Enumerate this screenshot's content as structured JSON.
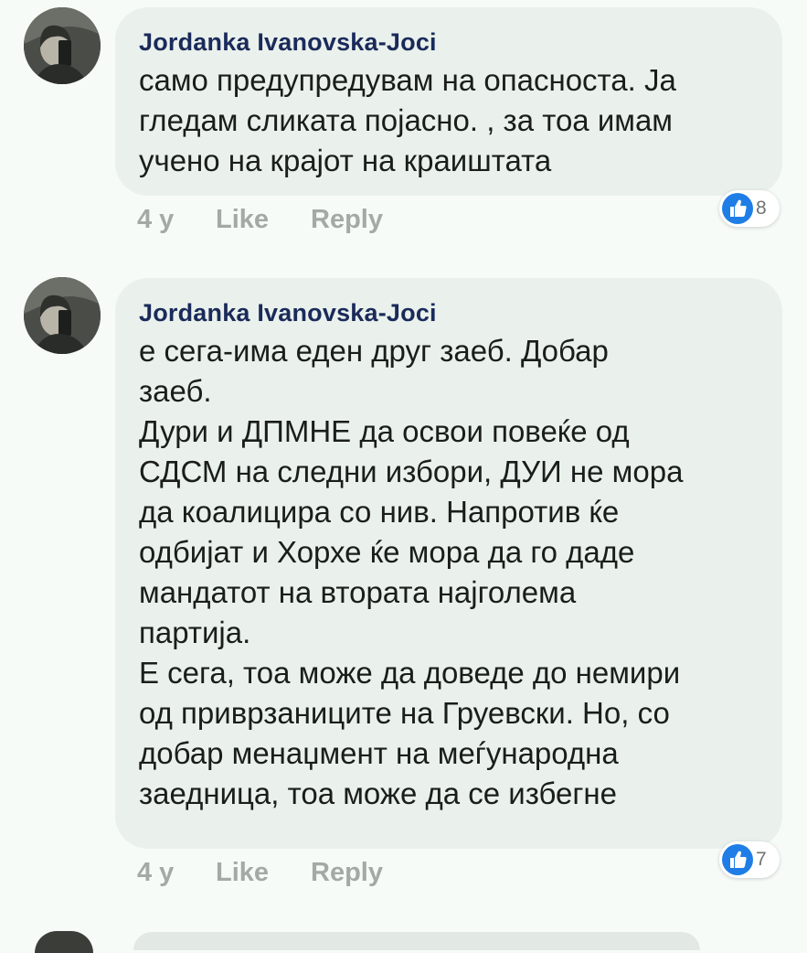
{
  "comments": [
    {
      "author": "Jordanka Ivanovska-Joci",
      "text_lines": [
        "само предупредувам на опасноста. Ја",
        "гледам сликата појасно. , за тоа имам",
        "учено на крајот на краиштата"
      ],
      "time": "4 y",
      "like_label": "Like",
      "reply_label": "Reply",
      "reaction_count": "8",
      "reaction_icon": "thumbs-up-icon"
    },
    {
      "author": "Jordanka Ivanovska-Joci",
      "text_lines": [
        "е сега-има еден друг заеб. Добар",
        "заеб.",
        "Дури и ДПМНЕ да освои повеќе од",
        "СДСМ на следни избори, ДУИ не мора",
        "да коалицира со нив. Напротив ќе",
        "одбијат и Хорхе ќе мора да го даде",
        "мандатот на втората најголема",
        "партија.",
        "Е сега, тоа може да доведе до немири",
        "од приврзаниците на Груевски. Но, со",
        "добар менаџмент на меѓународна",
        "заедница, тоа може да се избегне"
      ],
      "time": "4 y",
      "like_label": "Like",
      "reply_label": "Reply",
      "reaction_count": "7",
      "reaction_icon": "thumbs-up-icon"
    }
  ],
  "colors": {
    "background": "#f7fbf8",
    "bubble": "#eaf1ec",
    "author": "#1a2a5a",
    "meta": "#a2a9a6",
    "like_blue": "#1f7ee6"
  }
}
